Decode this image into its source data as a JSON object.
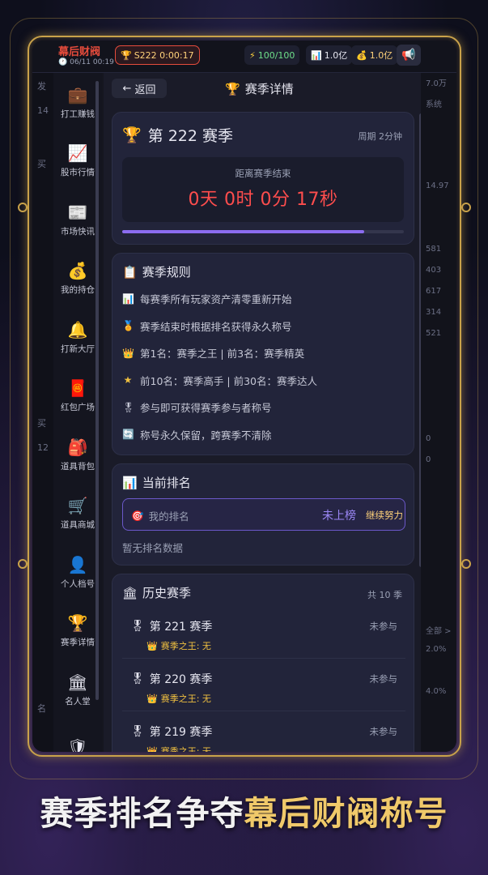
{
  "topbar": {
    "app_title": "幕后财阀",
    "time": "06/11 00:19",
    "season_badge": "S222 0:00:17",
    "energy": "100/100",
    "asset": "1.0亿",
    "cash": "1.0亿"
  },
  "background_strip_left": [
    "发",
    "14",
    "",
    "买",
    "",
    "",
    "",
    "",
    "",
    "",
    "",
    "",
    "",
    "买",
    "12",
    "",
    "",
    "",
    "",
    "",
    "",
    "",
    "",
    "",
    "名"
  ],
  "background_strip_right": [
    "7.0万",
    "系统",
    "",
    "",
    "",
    "14.97",
    "",
    "",
    "581",
    "403",
    "617",
    "314",
    "521",
    "",
    "",
    "",
    "",
    "0",
    "0",
    "",
    "",
    "",
    "",
    "",
    "",
    "",
    "全部 >",
    "2.0%",
    "",
    "4.0%"
  ],
  "sidebar": {
    "items": [
      {
        "icon": "briefcase-icon",
        "glyph": "💼",
        "label": "打工赚钱"
      },
      {
        "icon": "chart-up-icon",
        "glyph": "📈",
        "label": "股市行情"
      },
      {
        "icon": "newspaper-icon",
        "glyph": "📰",
        "label": "市场快讯"
      },
      {
        "icon": "money-bag-icon",
        "glyph": "💰",
        "label": "我的持仓"
      },
      {
        "icon": "bell-icon",
        "glyph": "🔔",
        "label": "打新大厅"
      },
      {
        "icon": "red-packet-icon",
        "glyph": "🧧",
        "label": "红包广场"
      },
      {
        "icon": "backpack-icon",
        "glyph": "🎒",
        "label": "道具背包"
      },
      {
        "icon": "cart-icon",
        "glyph": "🛒",
        "label": "道具商城"
      },
      {
        "icon": "person-icon",
        "glyph": "👤",
        "label": "个人档号"
      },
      {
        "icon": "trophy-icon",
        "glyph": "🏆",
        "label": "赛季详情"
      },
      {
        "icon": "bank-icon",
        "glyph": "🏛",
        "label": "名人堂"
      },
      {
        "icon": "shield-icon",
        "glyph": "🛡",
        "label": ""
      }
    ]
  },
  "header": {
    "back_label": "返回",
    "title": "赛季详情"
  },
  "season_card": {
    "title": "第 222 赛季",
    "cycle": "周期 2分钟",
    "countdown_label": "距离赛季结束",
    "countdown": "0天 0时 0分 17秒",
    "progress": 0.86
  },
  "rules": {
    "title": "赛季规则",
    "items": [
      {
        "glyph": "📊",
        "text": "每赛季所有玩家资产清零重新开始"
      },
      {
        "glyph": "🏅",
        "text": "赛季结束时根据排名获得永久称号"
      },
      {
        "glyph": "👑",
        "text": "第1名：赛季之王 | 前3名：赛季精英"
      },
      {
        "glyph": "★",
        "text": "前10名：赛季高手 | 前30名：赛季达人"
      },
      {
        "glyph": "🎖",
        "text": "参与即可获得赛季参与者称号"
      },
      {
        "glyph": "🔄",
        "text": "称号永久保留，跨赛季不清除"
      }
    ]
  },
  "ranking": {
    "title": "当前排名",
    "my_rank_label": "我的排名",
    "my_rank_value": "未上榜",
    "encourage": "继续努力",
    "no_data": "暂无排名数据"
  },
  "history": {
    "title": "历史赛季",
    "count": "共 10 季",
    "items": [
      {
        "name": "第 221 赛季",
        "status": "未参与",
        "king": "赛季之王: 无"
      },
      {
        "name": "第 220 赛季",
        "status": "未参与",
        "king": "赛季之王: 无"
      },
      {
        "name": "第 219 赛季",
        "status": "未参与",
        "king": "赛季之王: 无"
      }
    ]
  },
  "banner": {
    "text_part1": "赛季排名争夺",
    "text_part2": "幕后财阀称号"
  },
  "colors": {
    "accent_gold": "#c9a24a",
    "countdown_red": "#ff4d4d",
    "progress_purple": "#8b6cf0",
    "title_red": "#e74c3c"
  }
}
